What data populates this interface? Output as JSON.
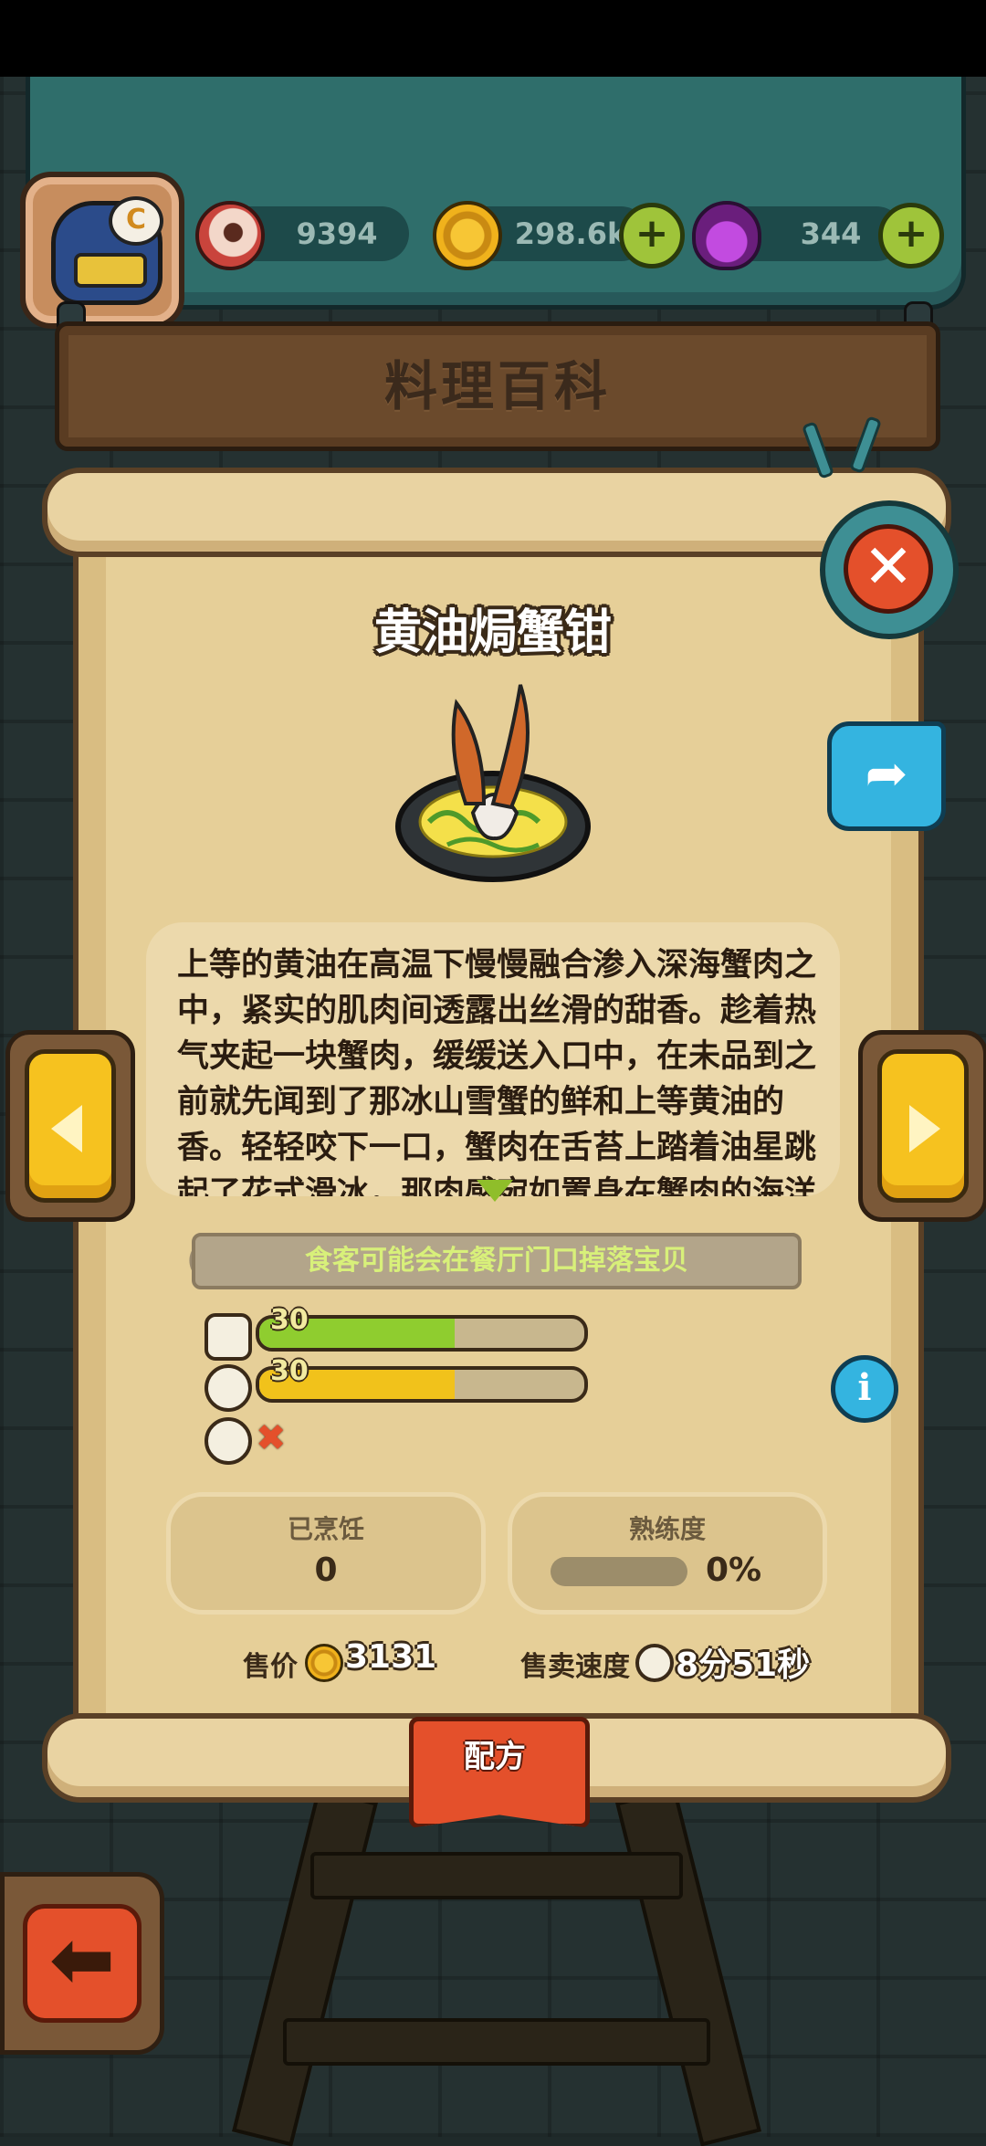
{
  "resources": {
    "eyes": "9394",
    "coins": "298.6k",
    "potions": "344"
  },
  "header": {
    "title": "料理百科"
  },
  "dish": {
    "name": "黄油焗蟹钳",
    "description": "上等的黄油在高温下慢慢融合渗入深海蟹肉之中，紧实的肌肉间透露出丝滑的甜香。趁着热气夹起一块蟹肉，缓缓送入口中，在未品到之前就先闻到了那冰山雪蟹的鲜和上等黄油的香。轻轻咬下一口，蟹肉在舌苔上踏着油星跳起了花式滑冰，那肉感宛如置身在蟹肉的海洋",
    "drop_hint": "食客可能会在餐厅门口掉落宝贝"
  },
  "stats": {
    "stat1_value": "30",
    "stat1_fill": 0.6,
    "stat2_value": "30",
    "stat2_fill": 0.6,
    "stat3_available": false
  },
  "cards": {
    "cooked_label": "已烹饪",
    "cooked_value": "0",
    "proficiency_label": "熟练度",
    "proficiency_value": "0%",
    "proficiency_fill": 0
  },
  "sale": {
    "price_label": "售价",
    "price_value": "3131",
    "speed_label": "售卖速度",
    "speed_value": "8分51秒"
  },
  "recipe_tab": {
    "label": "配方"
  },
  "colors": {
    "stat1": "#8fcd2f",
    "stat2": "#f1c21b",
    "accent_red": "#e4502b",
    "accent_blue": "#34b4e0"
  },
  "icons": {
    "close": "close-icon",
    "share": "share-icon",
    "info": "info-icon",
    "prev": "chevron-left-icon",
    "next": "chevron-right-icon",
    "back": "arrow-left-icon"
  }
}
